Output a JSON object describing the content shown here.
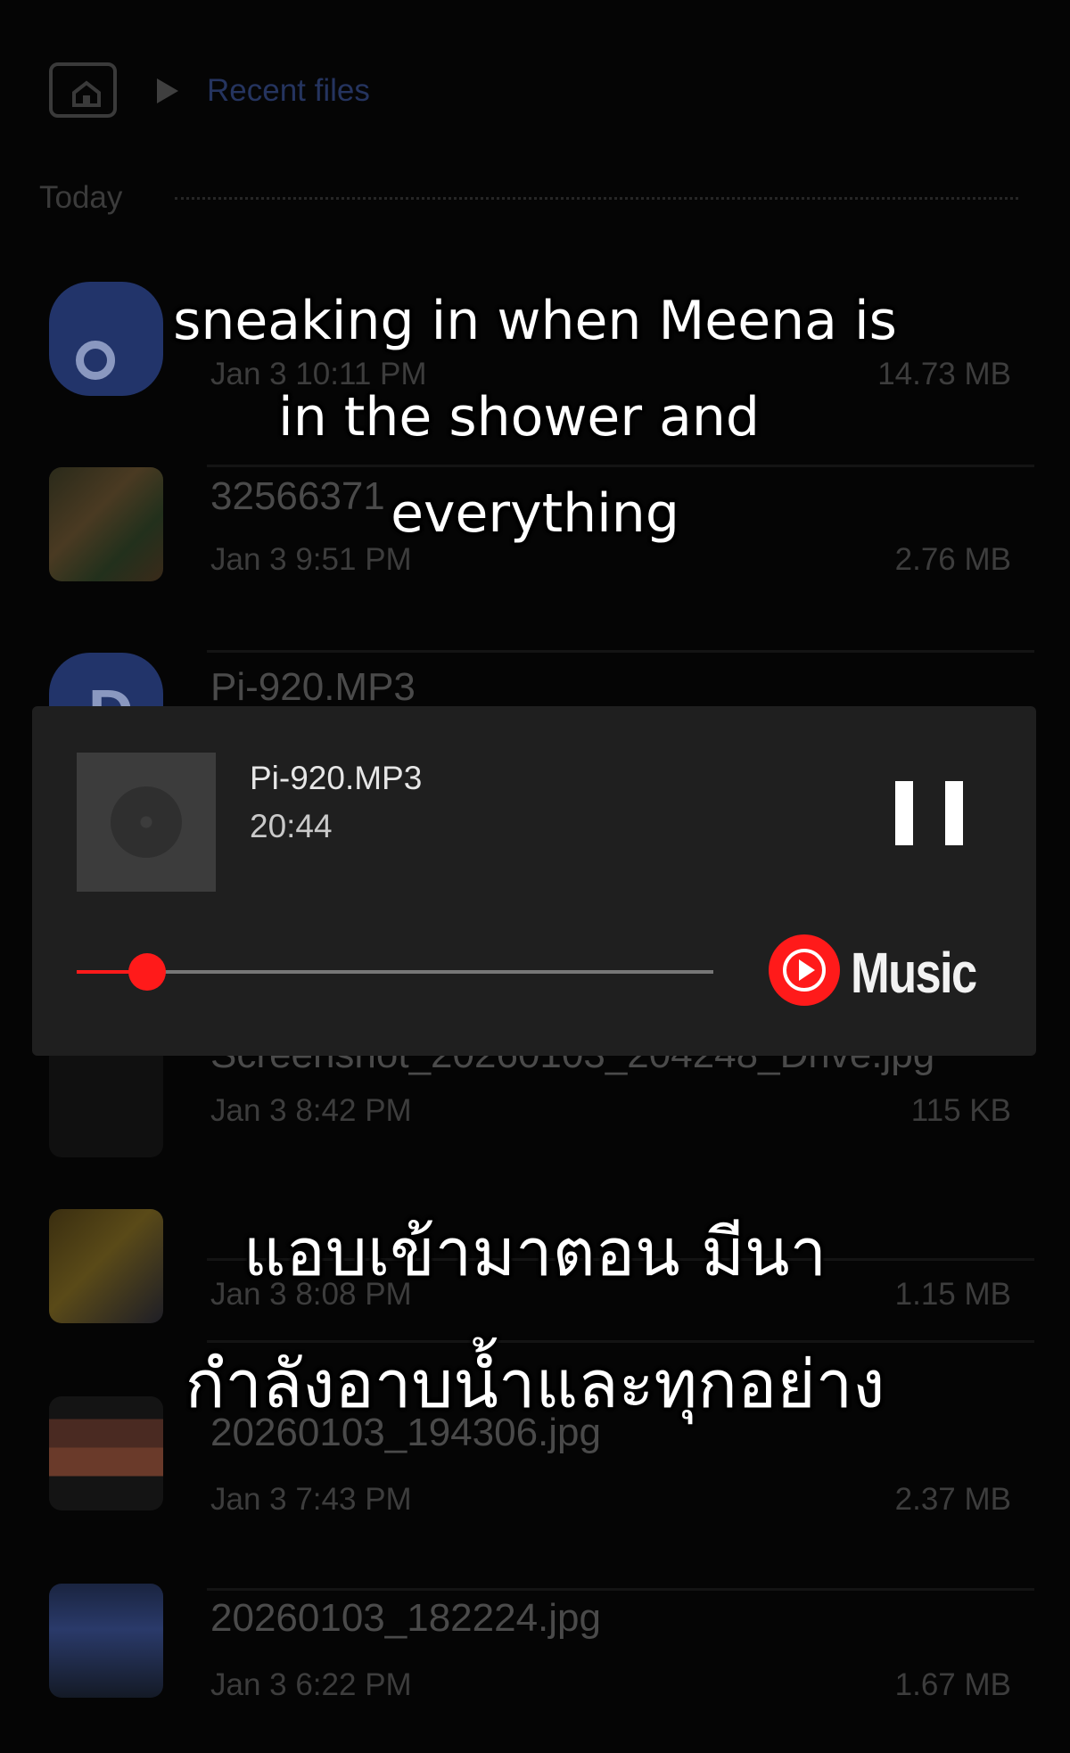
{
  "header": {
    "breadcrumb": "Recent files",
    "section": "Today"
  },
  "files": [
    {
      "name": "",
      "meta": "Jan 3 10:11 PM",
      "size": "14.73 MB",
      "icon": "music-file-icon"
    },
    {
      "name": "32566371",
      "meta": "Jan 3 9:51 PM",
      "size": "2.76 MB",
      "icon": "image-thumbnail"
    },
    {
      "name": "Pi-920.MP3",
      "meta": "",
      "size": "",
      "icon": "music-file-icon"
    },
    {
      "name": "Screenshot_20260103_204248_Drive.jpg",
      "meta": "Jan 3 8:42 PM",
      "size": "115 KB",
      "icon": "image-thumbnail"
    },
    {
      "name": "",
      "meta": "Jan 3 8:08 PM",
      "size": "1.15 MB",
      "icon": "image-thumbnail"
    },
    {
      "name": "20260103_194306.jpg",
      "meta": "Jan 3 7:43 PM",
      "size": "2.37 MB",
      "icon": "image-thumbnail"
    },
    {
      "name": "20260103_182224.jpg",
      "meta": "Jan 3 6:22 PM",
      "size": "1.67 MB",
      "icon": "image-thumbnail"
    }
  ],
  "player": {
    "title": "Pi-920.MP3",
    "time": "20:44",
    "progress": 0.11,
    "app_label": "Music",
    "accent": "#ff1a1a"
  },
  "captions": {
    "english": [
      "sneaking in when Meena is",
      "in the shower and",
      "everything"
    ],
    "thai": [
      "แอบเข้ามาตอน มีนา",
      "กำลังอาบน้ำและทุกอย่าง"
    ]
  }
}
